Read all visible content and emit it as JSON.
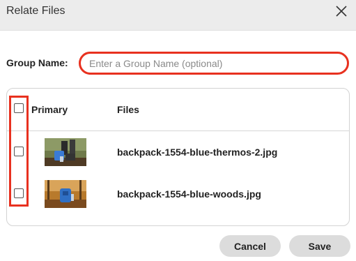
{
  "dialog": {
    "title": "Relate Files",
    "close_icon": "close-icon"
  },
  "group": {
    "label": "Group Name:",
    "value": "",
    "placeholder": "Enter a Group Name (optional)"
  },
  "table": {
    "columns": [
      "Primary",
      "Files"
    ],
    "select_all_checked": false,
    "rows": [
      {
        "checked": false,
        "thumbnail": "image-thumbnail",
        "file_name": "backpack-1554-blue-thermos-2.jpg"
      },
      {
        "checked": false,
        "thumbnail": "image-thumbnail",
        "file_name": "backpack-1554-blue-woods.jpg"
      }
    ]
  },
  "actions": {
    "cancel_label": "Cancel",
    "save_label": "Save"
  },
  "colors": {
    "highlight": "#e8311f",
    "button_bg": "#dcdcdc",
    "header_bg": "#ececec"
  }
}
